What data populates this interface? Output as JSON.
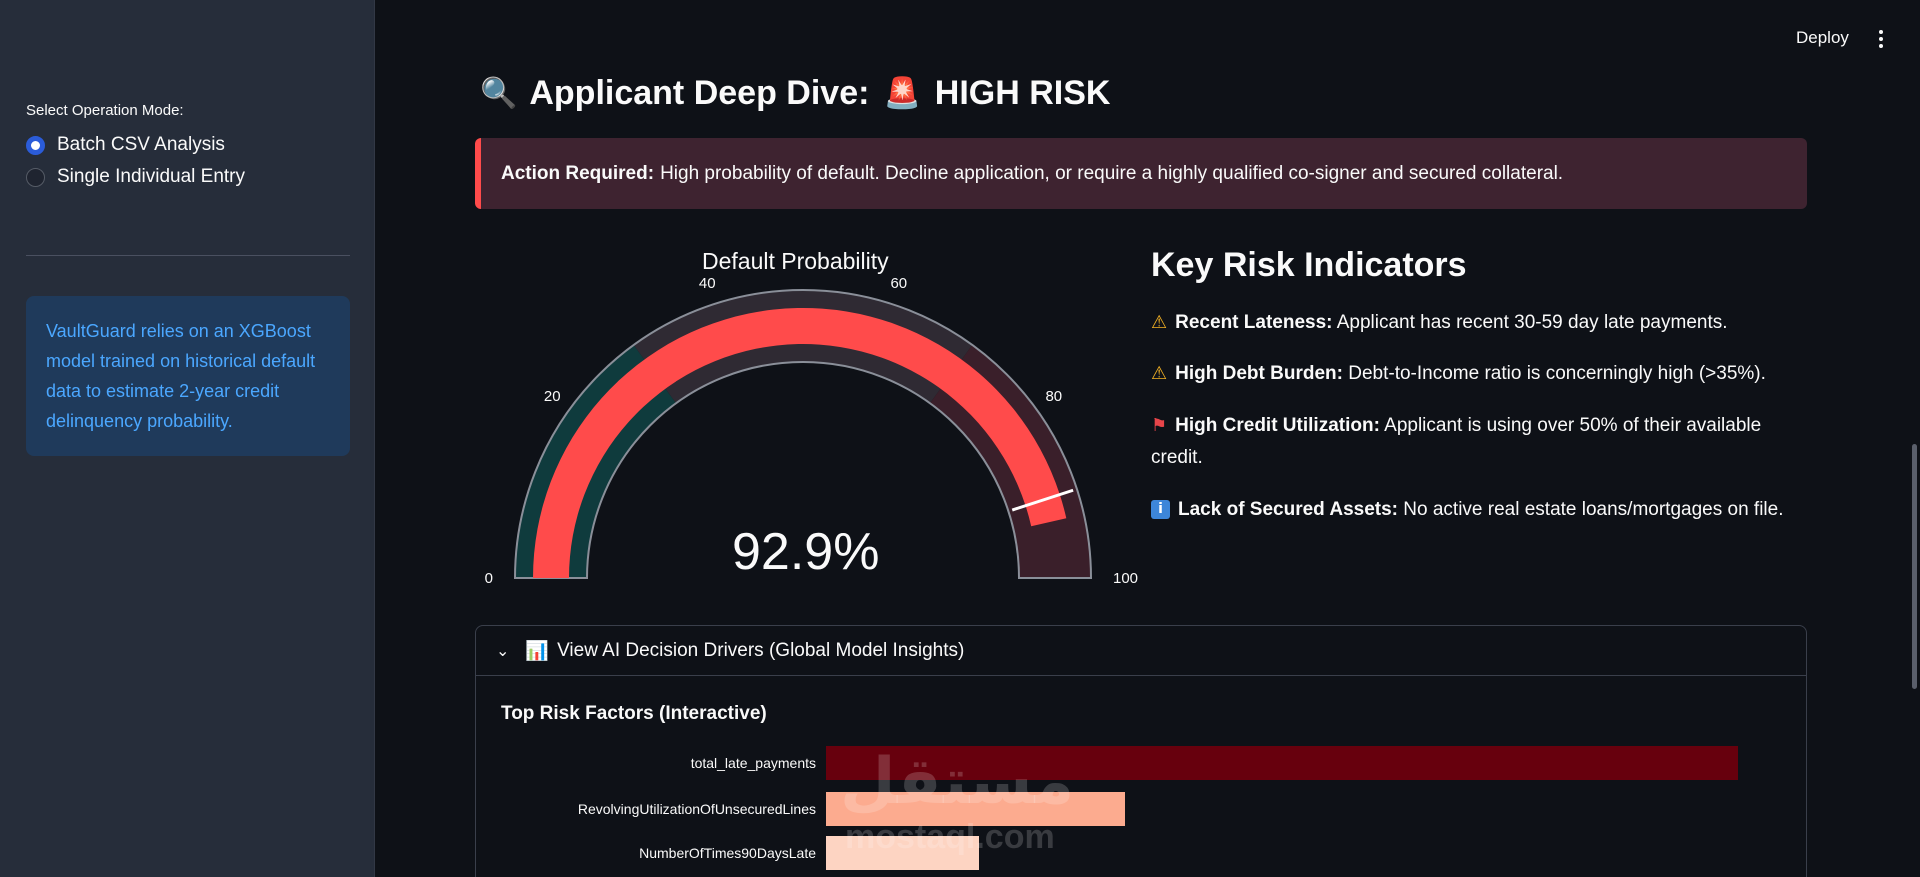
{
  "sidebar": {
    "mode_label": "Select Operation Mode:",
    "options": [
      {
        "label": "Batch CSV Analysis",
        "selected": true
      },
      {
        "label": "Single Individual Entry",
        "selected": false
      }
    ],
    "info_text": "VaultGuard relies on an XGBoost model trained on historical default data to estimate 2-year credit delinquency probability."
  },
  "topbar": {
    "deploy_label": "Deploy",
    "menu_icon": "kebab-menu-icon"
  },
  "header": {
    "search_emoji": "🔍",
    "title": "Applicant Deep Dive:",
    "alarm_emoji": "🚨",
    "risk_label": "HIGH RISK"
  },
  "alert": {
    "bold": "Action Required:",
    "text": "High probability of default. Decline application, or require a highly qualified co-signer and secured collateral."
  },
  "gauge": {
    "title": "Default Probability",
    "value": 92.9,
    "value_text": "92.9%",
    "min": 0,
    "max": 100,
    "ticks": [
      "0",
      "20",
      "40",
      "60",
      "80",
      "100"
    ],
    "steps": [
      {
        "from": 0,
        "to": 30,
        "color": "#0f3b3d"
      },
      {
        "from": 30,
        "to": 70,
        "color": "#2f2a33"
      },
      {
        "from": 70,
        "to": 100,
        "color": "#3a1f2a"
      }
    ],
    "bar_color": "#ff4b4b",
    "threshold": 90
  },
  "kri": {
    "title": "Key Risk Indicators",
    "items": [
      {
        "icon": "warning-icon",
        "glyph": "⚠",
        "bold": "Recent Lateness:",
        "text": "Applicant has recent 30-59 day late payments."
      },
      {
        "icon": "warning-icon",
        "glyph": "⚠",
        "bold": "High Debt Burden:",
        "text": "Debt-to-Income ratio is concerningly high (>35%)."
      },
      {
        "icon": "flag-icon",
        "glyph": "⚑",
        "bold": "High Credit Utilization:",
        "text": "Applicant is using over 50% of their available credit."
      },
      {
        "icon": "info-icon",
        "glyph": "i",
        "bold": "Lack of Secured Assets:",
        "text": "No active real estate loans/mortgages on file."
      }
    ]
  },
  "expander": {
    "chevron": "⌄",
    "icon": "📊",
    "label": "View AI Decision Drivers (Global Model Insights)",
    "subtitle": "Top Risk Factors (Interactive)"
  },
  "chart_data": {
    "type": "bar",
    "orientation": "horizontal",
    "categories": [
      "total_late_payments",
      "RevolvingUtilizationOfUnsecuredLines",
      "NumberOfTimes90DaysLate"
    ],
    "values": [
      1.0,
      0.328,
      0.168
    ],
    "colors": [
      "#67000d",
      "#fcab8f",
      "#fdd4c2"
    ],
    "title": "Top Risk Factors (Interactive)"
  },
  "watermark": {
    "arabic": "مستقل",
    "latin": "mostaql.com"
  }
}
